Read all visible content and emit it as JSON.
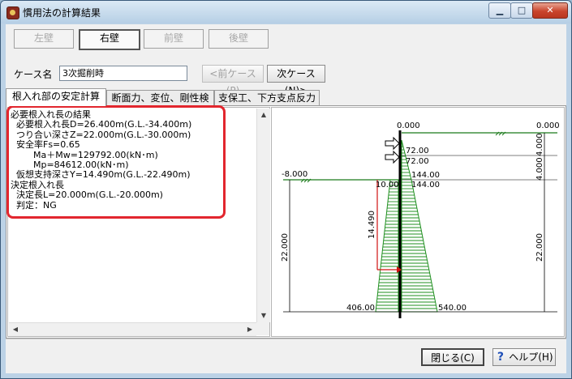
{
  "window": {
    "title": "慣用法の計算結果",
    "controls": [
      "minimize-icon",
      "maximize-icon",
      "close-icon"
    ]
  },
  "walls": [
    {
      "label": "左壁",
      "state": "disabled"
    },
    {
      "label": "右壁",
      "state": "selected"
    },
    {
      "label": "前壁",
      "state": "disabled"
    },
    {
      "label": "後壁",
      "state": "disabled"
    }
  ],
  "case": {
    "label": "ケース名",
    "value": "3次掘削時",
    "prev_label": "<前ケース(P)",
    "next_label": "次ケース(N)>"
  },
  "tabs": [
    {
      "label": "根入れ部の安定計算",
      "active": true
    },
    {
      "label": "断面力、変位、剛性検討",
      "active": false
    },
    {
      "label": "支保工、下方支点反力",
      "active": false
    }
  ],
  "results": [
    "必要根入れ長の結果",
    "  必要根入れ長D=26.400m(G.L.-34.400m)",
    "  つり合い深さZ=22.000m(G.L.-30.000m)",
    "  安全率Fs=0.65",
    "        Ma＋Mw=129792.00(kN･m)",
    "        Mp=84612.00(kN･m)",
    "  仮想支持深さY=14.490m(G.L.-22.490m)",
    "決定根入れ長",
    "  決定長L=20.000m(G.L.-20.000m)",
    "  判定：NG"
  ],
  "diagram": {
    "top_left": "0.000",
    "top_right": "0.000",
    "left_level": "-8.000",
    "support_values": [
      "72.00",
      "72.00"
    ],
    "values_144": [
      "144.00",
      "144.00"
    ],
    "small_left": "10.00",
    "depth_14490": "14.490",
    "dim_right_upper": "4.000",
    "dim_right_mid": "4.000",
    "dim_22_left": "22.000",
    "dim_22_right": "22.000",
    "bottom_left": "406.00",
    "bottom_right": "540.00",
    "colors": {
      "ground": "#1a7a1a",
      "fill": "#1f8f1f",
      "wall": "#000000",
      "arrow": "#d01010"
    }
  },
  "footer": {
    "close_label": "閉じる(C)",
    "help_label": "ヘルプ(H)"
  }
}
